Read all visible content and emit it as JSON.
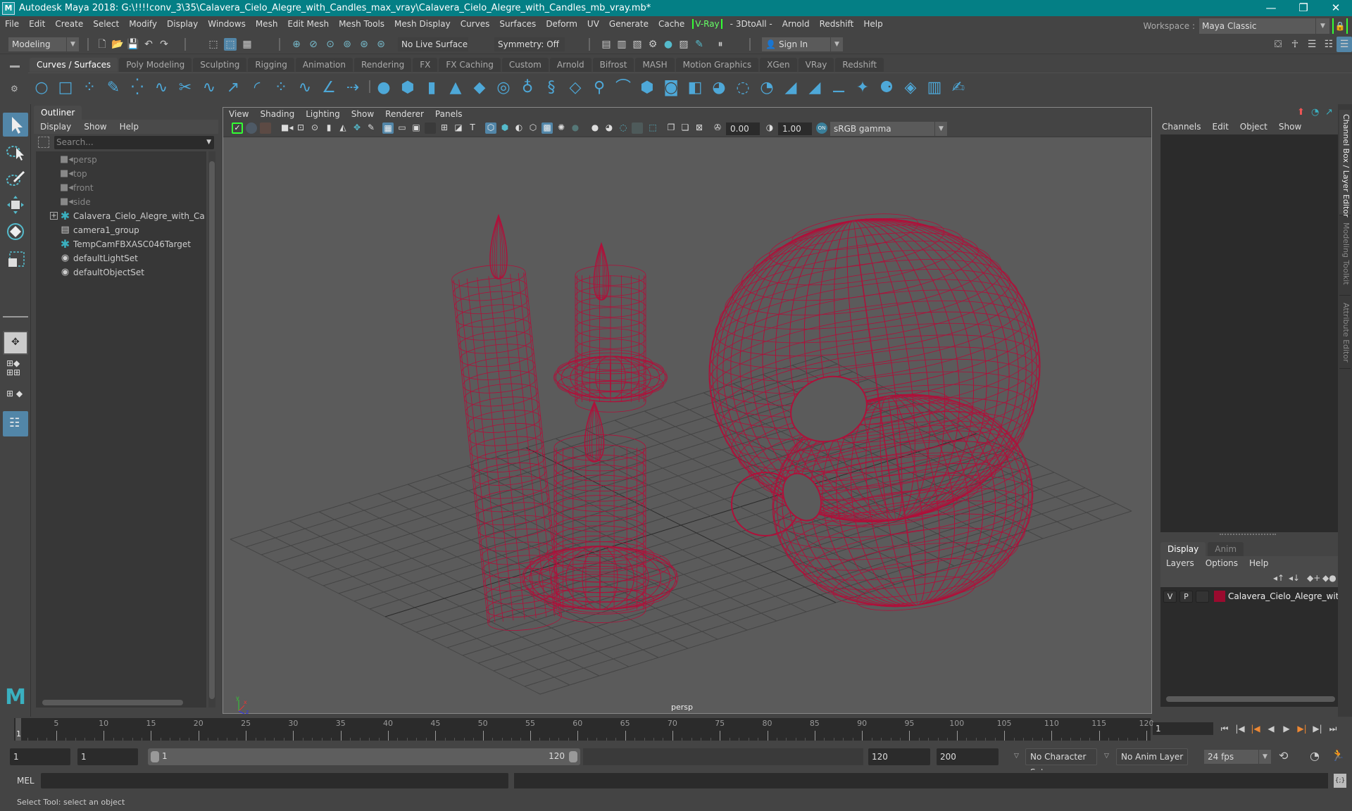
{
  "titlebar": {
    "title": "Autodesk Maya 2018: G:\\!!!!conv_3\\35\\Calavera_Cielo_Alegre_with_Candles_max_vray\\Calavera_Cielo_Alegre_with_Candles_mb_vray.mb*",
    "logo": "M",
    "minimize": "—",
    "maximize": "❐",
    "close": "✕"
  },
  "menubar": {
    "items": [
      "File",
      "Edit",
      "Create",
      "Select",
      "Modify",
      "Display",
      "Windows",
      "Mesh",
      "Edit Mesh",
      "Mesh Tools",
      "Mesh Display",
      "Curves",
      "Surfaces",
      "Deform",
      "UV",
      "Generate",
      "Cache",
      "V-Ray",
      "- 3DtoAll -",
      "Arnold",
      "Redshift",
      "Help"
    ]
  },
  "workspace": {
    "label": "Workspace :",
    "value": "Maya Classic"
  },
  "statusline": {
    "mode": "Modeling",
    "live_surface": "No Live Surface",
    "symmetry": "Symmetry: Off",
    "sign_in": "Sign In"
  },
  "shelf": {
    "tabs": [
      "Curves / Surfaces",
      "Poly Modeling",
      "Sculpting",
      "Rigging",
      "Animation",
      "Rendering",
      "FX",
      "FX Caching",
      "Custom",
      "Arnold",
      "Bifrost",
      "MASH",
      "Motion Graphics",
      "XGen",
      "VRay",
      "Redshift"
    ],
    "active_tab": 0,
    "icons": [
      "nurbs-circle-icon",
      "nurbs-square-icon",
      "cv-curve-icon",
      "pencil-curve-icon",
      "ep-curve-icon",
      "bezier-curve-icon",
      "cut-curve-icon",
      "curve-point-icon",
      "extend-curve-icon",
      "arc-icon",
      "rebuild-curve-icon",
      "reverse-curve-icon",
      "fillet-curve-icon",
      "attach-curve-icon",
      "nurbs-sphere-icon",
      "nurbs-cube-icon",
      "nurbs-cylinder-icon",
      "nurbs-cone-icon",
      "nurbs-plane-icon",
      "nurbs-torus-icon",
      "revolve-icon",
      "loft-icon",
      "planar-icon",
      "extrude-icon",
      "birail-icon",
      "bevel-icon",
      "trim-icon",
      "square-surface-icon",
      "boundary-icon",
      "untrim-icon",
      "project-curve-icon",
      "intersect-icon",
      "insert-isoparm-icon",
      "offset-surface-icon",
      "detach-surface-icon",
      "attach-surface-icon",
      "sculpt-surface-icon",
      "paint-surface-icon",
      "rebuild-surface-icon"
    ]
  },
  "outliner": {
    "tab": "Outliner",
    "menu": [
      "Display",
      "Show",
      "Help"
    ],
    "search_placeholder": "Search...",
    "items": [
      {
        "label": "persp",
        "icon": "camera-icon",
        "dim": true
      },
      {
        "label": "top",
        "icon": "camera-icon",
        "dim": true
      },
      {
        "label": "front",
        "icon": "camera-icon",
        "dim": true
      },
      {
        "label": "side",
        "icon": "camera-icon",
        "dim": true
      },
      {
        "label": "Calavera_Cielo_Alegre_with_Candles_",
        "icon": "locator-icon",
        "dim": false,
        "expandable": true
      },
      {
        "label": "camera1_group",
        "icon": "group-icon",
        "dim": false
      },
      {
        "label": "TempCamFBXASC046Target",
        "icon": "locator-icon",
        "dim": false
      },
      {
        "label": "defaultLightSet",
        "icon": "set-icon",
        "dim": false
      },
      {
        "label": "defaultObjectSet",
        "icon": "set-icon",
        "dim": false
      }
    ]
  },
  "viewport": {
    "menu": [
      "View",
      "Shading",
      "Lighting",
      "Show",
      "Renderer",
      "Panels"
    ],
    "exposure": "0.00",
    "gamma": "1.00",
    "color_space": "sRGB gamma",
    "camera": "persp",
    "wire_color": "#b0103a",
    "axis": {
      "x": "x",
      "y": "y",
      "z": "z"
    }
  },
  "channel_box": {
    "menu": [
      "Channels",
      "Edit",
      "Object",
      "Show"
    ]
  },
  "layer_editor": {
    "tabs": [
      "Display",
      "Anim"
    ],
    "active_tab": 0,
    "menu": [
      "Layers",
      "Options",
      "Help"
    ],
    "layers": [
      {
        "v": "V",
        "p": "P",
        "color": "#9a0a2e",
        "name": "Calavera_Cielo_Alegre_with_Ca"
      }
    ]
  },
  "side_tabs": [
    "Channel Box / Layer Editor",
    "Modeling Toolkit",
    "Attribute Editor"
  ],
  "timeslider": {
    "start": 1,
    "end": 120,
    "current": 1,
    "labels": [
      "5",
      "10",
      "15",
      "20",
      "25",
      "30",
      "35",
      "40",
      "45",
      "50",
      "55",
      "60",
      "65",
      "70",
      "75",
      "80",
      "85",
      "90",
      "95",
      "100",
      "105",
      "110",
      "115",
      "120"
    ],
    "current_frame": "1",
    "current_label": "1"
  },
  "rangeslider": {
    "start_frame": "1",
    "playback_start": "1",
    "range_start": "1",
    "range_end": "120",
    "playback_end": "120",
    "end_frame": "200",
    "character_set": "No Character Set",
    "anim_layer": "No Anim Layer",
    "fps": "24 fps"
  },
  "cmdline": {
    "label": "MEL",
    "value": ""
  },
  "statusbar": {
    "message": "Select Tool: select an object"
  }
}
